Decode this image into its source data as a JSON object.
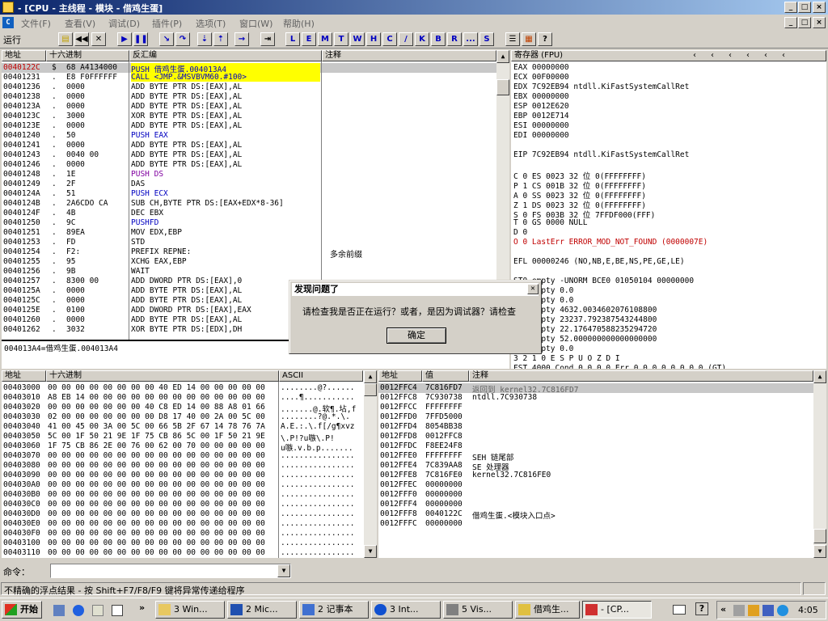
{
  "window": {
    "title": "- [CPU - 主线程 - 模块 - 借鸡生蛋]"
  },
  "menu": [
    "文件(F)",
    "查看(V)",
    "调试(D)",
    "插件(P)",
    "选项(T)",
    "窗口(W)",
    "帮助(H)"
  ],
  "mdi_buttons": [
    "_",
    "□",
    "×"
  ],
  "toolbar": {
    "status": "运行",
    "letters": [
      "L",
      "E",
      "M",
      "T",
      "W",
      "H",
      "C",
      "/",
      "K",
      "B",
      "R",
      "...",
      "S"
    ]
  },
  "disasm": {
    "headers": {
      "addr": "地址",
      "hex": "十六进制",
      "asm": "反汇编",
      "comment": "注释"
    },
    "rows": [
      {
        "a": "0040122C",
        "m": "$",
        "h": "68 A4134000",
        "i": "PUSH 借鸡生蛋.004013A4",
        "c": ""
      },
      {
        "a": "00401231",
        "m": ".",
        "h": "E8 F0FFFFFF",
        "i": "CALL <JMP.&MSVBVM60.#100>",
        "c": ""
      },
      {
        "a": "00401236",
        "m": ".",
        "h": "0000",
        "i": "ADD BYTE PTR DS:[EAX],AL",
        "c": ""
      },
      {
        "a": "00401238",
        "m": ".",
        "h": "0000",
        "i": "ADD BYTE PTR DS:[EAX],AL",
        "c": ""
      },
      {
        "a": "0040123A",
        "m": ".",
        "h": "0000",
        "i": "ADD BYTE PTR DS:[EAX],AL",
        "c": ""
      },
      {
        "a": "0040123C",
        "m": ".",
        "h": "3000",
        "i": "XOR BYTE PTR DS:[EAX],AL",
        "c": ""
      },
      {
        "a": "0040123E",
        "m": ".",
        "h": "0000",
        "i": "ADD BYTE PTR DS:[EAX],AL",
        "c": ""
      },
      {
        "a": "00401240",
        "m": ".",
        "h": "50",
        "i": "PUSH EAX",
        "c": ""
      },
      {
        "a": "00401241",
        "m": ".",
        "h": "0000",
        "i": "ADD BYTE PTR DS:[EAX],AL",
        "c": ""
      },
      {
        "a": "00401243",
        "m": ".",
        "h": "0040 00",
        "i": "ADD BYTE PTR DS:[EAX],AL",
        "c": ""
      },
      {
        "a": "00401246",
        "m": ".",
        "h": "0000",
        "i": "ADD BYTE PTR DS:[EAX],AL",
        "c": ""
      },
      {
        "a": "00401248",
        "m": ".",
        "h": "1E",
        "i": "PUSH DS",
        "c": ""
      },
      {
        "a": "00401249",
        "m": ".",
        "h": "2F",
        "i": "DAS",
        "c": ""
      },
      {
        "a": "0040124A",
        "m": ".",
        "h": "51",
        "i": "PUSH ECX",
        "c": ""
      },
      {
        "a": "0040124B",
        "m": ".",
        "h": "2A6CDO CA",
        "i": "SUB CH,BYTE PTR DS:[EAX+EDX*8-36]",
        "c": ""
      },
      {
        "a": "0040124F",
        "m": ".",
        "h": "4B",
        "i": "DEC EBX",
        "c": ""
      },
      {
        "a": "00401250",
        "m": ".",
        "h": "9C",
        "i": "PUSHFD",
        "c": ""
      },
      {
        "a": "00401251",
        "m": ".",
        "h": "89EA",
        "i": "MOV EDX,EBP",
        "c": ""
      },
      {
        "a": "00401253",
        "m": ".",
        "h": "FD",
        "i": "STD",
        "c": ""
      },
      {
        "a": "00401254",
        "m": ".",
        "h": "F2:",
        "i": "PREFIX REPNE:",
        "c": "多余前缀"
      },
      {
        "a": "00401255",
        "m": ".",
        "h": "95",
        "i": "XCHG EAX,EBP",
        "c": ""
      },
      {
        "a": "00401256",
        "m": ".",
        "h": "9B",
        "i": "WAIT",
        "c": ""
      },
      {
        "a": "00401257",
        "m": ".",
        "h": "8300 00",
        "i": "ADD DWORD PTR DS:[EAX],0",
        "c": ""
      },
      {
        "a": "0040125A",
        "m": ".",
        "h": "0000",
        "i": "ADD BYTE PTR DS:[EAX],AL",
        "c": ""
      },
      {
        "a": "0040125C",
        "m": ".",
        "h": "0000",
        "i": "ADD BYTE PTR DS:[EAX],AL",
        "c": ""
      },
      {
        "a": "0040125E",
        "m": ".",
        "h": "0100",
        "i": "ADD DWORD PTR DS:[EAX],EAX",
        "c": ""
      },
      {
        "a": "00401260",
        "m": ".",
        "h": "0000",
        "i": "ADD BYTE PTR DS:[EAX],AL",
        "c": ""
      },
      {
        "a": "00401262",
        "m": ".",
        "h": "3032",
        "i": "XOR BYTE PTR DS:[EDX],DH",
        "c": ""
      }
    ],
    "info": "004013A4=借鸡生蛋.004013A4"
  },
  "registers": {
    "header": "寄存器 (FPU)",
    "lines": [
      "EAX 00000000",
      "ECX 00F00000",
      "EDX 7C92EB94 ntdll.KiFastSystemCallRet",
      "EBX 00000000",
      "ESP 0012E620",
      "EBP 0012E714",
      "ESI 00000000",
      "EDI 00000000",
      "",
      "EIP 7C92EB94 ntdll.KiFastSystemCallRet",
      "",
      "C 0  ES 0023 32 位 0(FFFFFFFF)",
      "P 1  CS 001B 32 位 0(FFFFFFFF)",
      "A 0  SS 0023 32 位 0(FFFFFFFF)",
      "Z 1  DS 0023 32 位 0(FFFFFFFF)",
      "S 0  FS 003B 32 位 7FFDF000(FFF)",
      "T 0  GS 0000 NULL",
      "D 0",
      "O 0  LastErr ERROR_MOD_NOT_FOUND (0000007E)",
      "",
      "EFL 00000246 (NO,NB,E,BE,NS,PE,GE,LE)",
      "",
      "ST0 empty -UNORM BCE0 01050104 00000000",
      "ST1 empty 0.0",
      "ST2 empty 0.0",
      "ST3 empty 4632.0034602076108800",
      "ST4 empty 23237.792387543244800",
      "ST5 empty 22.176470588235294720",
      "ST6 empty 52.000000000000000000",
      "ST7 empty 0.0",
      "               3 2 1 0      E S P U O Z D I",
      "FST 4000  Cond 0 0 0 0  Err 0 0 0 0 0 0 0 0  (GT)",
      "FCW 137F  Prec NEAR,64  Mask    1 1 1 1 1 1"
    ]
  },
  "dump": {
    "headers": {
      "addr": "地址",
      "hex": "十六进制",
      "ascii": "ASCII"
    },
    "rows": [
      {
        "a": "00403000",
        "h": "00 00 00 00 00 00 00 00 40 ED 14 00 00 00 00 00",
        "s": "........@?......"
      },
      {
        "a": "00403010",
        "h": "A8 EB 14 00 00 00 00 00 00 00 00 00 00 00 00 00",
        "s": "....¶..........."
      },
      {
        "a": "00403020",
        "h": "00 00 00 00 00 00 00 40 C8 ED 14 00 88 A8 01 66",
        "s": ".......@.软¶.坫,f"
      },
      {
        "a": "00403030",
        "h": "02 00 00 00 00 00 00 00 D8 17 40 00 2A 00 5C 00",
        "s": "........?@.*.\\."
      },
      {
        "a": "00403040",
        "h": "41 00 45 00 3A 00 5C 00 66 5B 2F 67 14 78 76 7A",
        "s": "A.E.:.\\.f[/g¶xvz"
      },
      {
        "a": "00403050",
        "h": "5C 00 1F 50 21 9E 1F 75 CB 86 5C 00 1F 50 21 9E",
        "s": "\\.P!?u嗾\\.P!"
      },
      {
        "a": "00403060",
        "h": "1F 75 CB 86 2E 00 76 00 62 00 70 00 00 00 00 00",
        "s": "u嗾.v.b.p......."
      },
      {
        "a": "00403070",
        "h": "00 00 00 00 00 00 00 00 00 00 00 00 00 00 00 00",
        "s": "................"
      },
      {
        "a": "00403080",
        "h": "00 00 00 00 00 00 00 00 00 00 00 00 00 00 00 00",
        "s": "................"
      },
      {
        "a": "00403090",
        "h": "00 00 00 00 00 00 00 00 00 00 00 00 00 00 00 00",
        "s": "................"
      },
      {
        "a": "004030A0",
        "h": "00 00 00 00 00 00 00 00 00 00 00 00 00 00 00 00",
        "s": "................"
      },
      {
        "a": "004030B0",
        "h": "00 00 00 00 00 00 00 00 00 00 00 00 00 00 00 00",
        "s": "................"
      },
      {
        "a": "004030C0",
        "h": "00 00 00 00 00 00 00 00 00 00 00 00 00 00 00 00",
        "s": "................"
      },
      {
        "a": "004030D0",
        "h": "00 00 00 00 00 00 00 00 00 00 00 00 00 00 00 00",
        "s": "................"
      },
      {
        "a": "004030E0",
        "h": "00 00 00 00 00 00 00 00 00 00 00 00 00 00 00 00",
        "s": "................"
      },
      {
        "a": "004030F0",
        "h": "00 00 00 00 00 00 00 00 00 00 00 00 00 00 00 00",
        "s": "................"
      },
      {
        "a": "00403100",
        "h": "00 00 00 00 00 00 00 00 00 00 00 00 00 00 00 00",
        "s": "................"
      },
      {
        "a": "00403110",
        "h": "00 00 00 00 00 00 00 00 00 00 00 00 00 00 00 00",
        "s": "................"
      }
    ]
  },
  "stack": {
    "headers": {
      "addr": "地址",
      "val": "值",
      "comment": "注释"
    },
    "rows": [
      {
        "a": "0012FFC4",
        "v": "7C816FD7",
        "c": "返回到 kernel32.7C816FD7"
      },
      {
        "a": "0012FFC8",
        "v": "7C930738",
        "c": "ntdll.7C930738"
      },
      {
        "a": "0012FFCC",
        "v": "FFFFFFFF",
        "c": ""
      },
      {
        "a": "0012FFD0",
        "v": "7FFD5000",
        "c": ""
      },
      {
        "a": "0012FFD4",
        "v": "8054BB38",
        "c": ""
      },
      {
        "a": "0012FFD8",
        "v": "0012FFC8",
        "c": ""
      },
      {
        "a": "0012FFDC",
        "v": "F8EE24F8",
        "c": ""
      },
      {
        "a": "0012FFE0",
        "v": "FFFFFFFF",
        "c": "SEH 链尾部"
      },
      {
        "a": "0012FFE4",
        "v": "7C839AA8",
        "c": "SE 处理器"
      },
      {
        "a": "0012FFE8",
        "v": "7C816FE0",
        "c": "kernel32.7C816FE0"
      },
      {
        "a": "0012FFEC",
        "v": "00000000",
        "c": ""
      },
      {
        "a": "0012FFF0",
        "v": "00000000",
        "c": ""
      },
      {
        "a": "0012FFF4",
        "v": "00000000",
        "c": ""
      },
      {
        "a": "0012FFF8",
        "v": "0040122C",
        "c": "借鸡生蛋.<模块入口点>"
      },
      {
        "a": "0012FFFC",
        "v": "00000000",
        "c": ""
      }
    ]
  },
  "dialog": {
    "title": "发现问题了",
    "message": "请检查我是否正在运行？或者，是因为调试器？请检查",
    "ok": "确定"
  },
  "command": {
    "label": "命令：",
    "value": ""
  },
  "status": {
    "text": "不精确的浮点结果 - 按 Shift+F7/F8/F9 键将异常传递给程序"
  },
  "taskbar": {
    "start": "开始",
    "tasks": [
      "3 Win...",
      "2 Mic...",
      "2 记事本",
      "3 Int...",
      "5 Vis...",
      "借鸡生...",
      "- [CP..."
    ],
    "clock": "4:05"
  }
}
